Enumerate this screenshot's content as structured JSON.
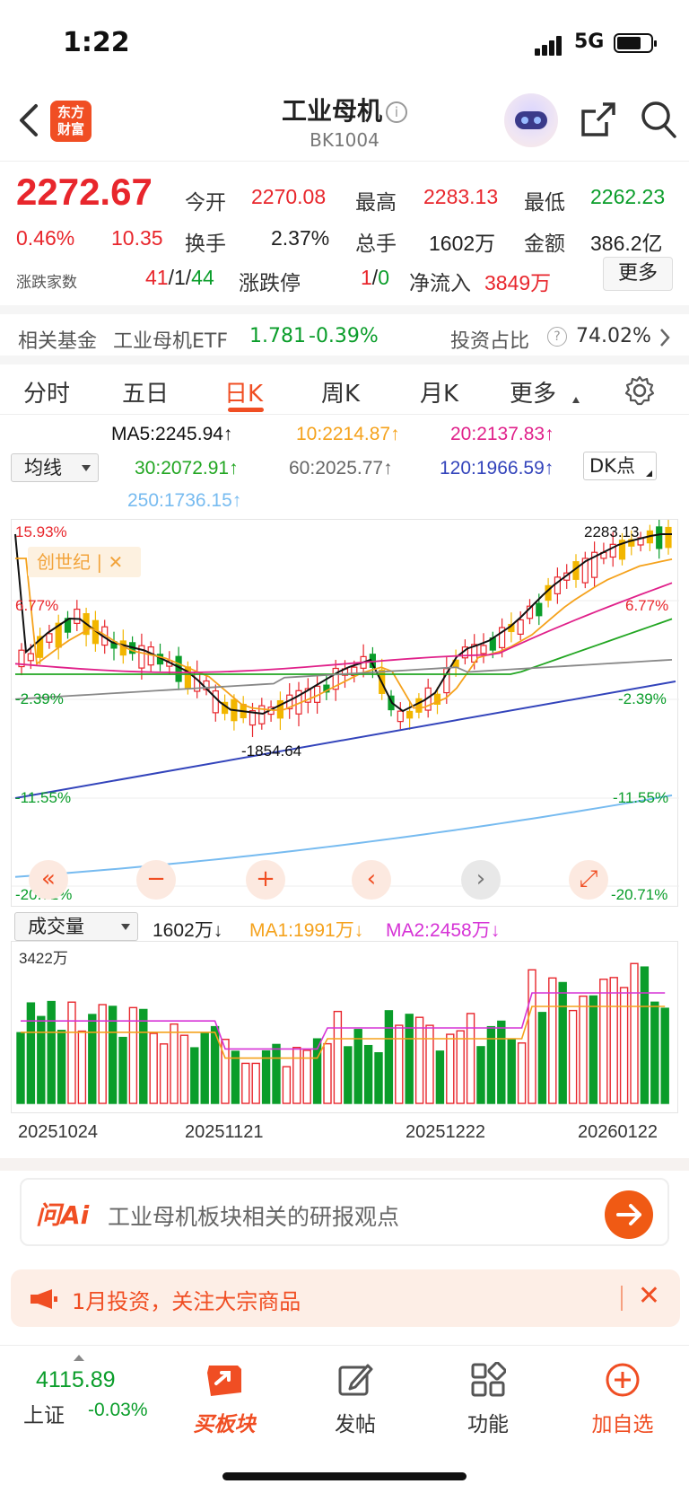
{
  "status": {
    "time": "1:22",
    "network": "5G"
  },
  "header": {
    "logo_line1": "东方",
    "logo_line2": "财富",
    "title": "工业母机",
    "info_glyph": "i",
    "code": "BK1004"
  },
  "quote": {
    "price": "2272.67",
    "change_pct": "0.46%",
    "change": "10.35",
    "open_label": "今开",
    "open": "2270.08",
    "high_label": "最高",
    "high": "2283.13",
    "low_label": "最低",
    "low": "2262.23",
    "turnover_label": "换手",
    "turnover": "2.37%",
    "volume_label": "总手",
    "volume": "1602万",
    "amount_label": "金额",
    "amount": "386.2亿",
    "breadth_label": "涨跌家数",
    "up": "41",
    "sep1": "/",
    "flat": "1",
    "sep2": "/",
    "down": "44",
    "limit_label": "涨跌停",
    "limit_up": "1",
    "sep3": "/",
    "limit_down": "0",
    "inflow_label": "净流入",
    "inflow": "3849万",
    "more": "更多"
  },
  "fund": {
    "label": "相关基金",
    "name": "工业母机ETF",
    "price": "1.781",
    "change": "-0.39%",
    "ratio_label": "投资占比",
    "help": "?",
    "ratio": "74.02%"
  },
  "tabs": [
    "分时",
    "五日",
    "日K",
    "周K",
    "月K",
    "更多"
  ],
  "active_tab": "日K",
  "ma": {
    "selector": "均线",
    "ma5": "MA5:2245.94↑",
    "ma10": "10:2214.87↑",
    "ma20": "20:2137.83↑",
    "ma30": "30:2072.91↑",
    "ma60": "60:2025.77↑",
    "ma120": "120:1966.59↑",
    "ma250": "250:1736.15↑",
    "dk": "DK点"
  },
  "chart": {
    "pct_labels": {
      "top": "15.93%",
      "p2": "6.77%",
      "p3": "-2.39%",
      "p4": "-11.55%",
      "p5": "-20.71%"
    },
    "badge": "创世纪 | ✕",
    "high_mark": "2283.13",
    "low_mark": "-1854.64",
    "controls": [
      "«",
      "−",
      "+",
      "‹",
      "›",
      "⤢"
    ]
  },
  "volume": {
    "selector": "成交量",
    "vol": "1602万↓",
    "ma1": "MA1:1991万↓",
    "ma2": "MA2:2458万↓",
    "max_label": "3422万",
    "dates": [
      "20251024",
      "20251121",
      "20251222",
      "20260122"
    ]
  },
  "ai": {
    "logo": "问Ai",
    "text": "工业母机板块相关的研报观点"
  },
  "notice": {
    "text": "1月投资，关注大宗商品",
    "close": "✕"
  },
  "bottom": {
    "index_value": "4115.89",
    "index_name": "上证",
    "index_change": "-0.03%",
    "items": [
      "买板块",
      "发帖",
      "功能",
      "加自选"
    ]
  },
  "colors": {
    "up": "#e8262c",
    "down": "#0a9d2a",
    "brand": "#f04e23",
    "ma5": "#111111",
    "ma10": "#f5a21c",
    "ma20": "#e0218a",
    "ma30": "#22a622",
    "ma60": "#888888",
    "ma120": "#3344bb",
    "ma250": "#77bbf0"
  }
}
